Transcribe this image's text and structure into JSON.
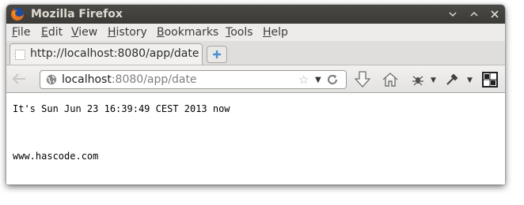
{
  "window": {
    "title": "Mozilla Firefox"
  },
  "menubar": {
    "items": [
      {
        "label": "File"
      },
      {
        "label": "Edit"
      },
      {
        "label": "View"
      },
      {
        "label": "History"
      },
      {
        "label": "Bookmarks"
      },
      {
        "label": "Tools"
      },
      {
        "label": "Help"
      }
    ]
  },
  "tabs": {
    "active_label": "http://localhost:8080/app/date"
  },
  "urlbar": {
    "host": "localhost",
    "path": ":8080/app/date"
  },
  "content": {
    "message": "It's Sun Jun 23 16:39:49 CEST 2013 now",
    "footer": "www.hascode.com"
  },
  "icons": {
    "app": "firefox-logo-icon",
    "minimize": "minimize-icon",
    "maximize": "maximize-icon",
    "close": "close-icon",
    "new_tab": "plus-icon",
    "back": "back-arrow-icon",
    "site": "globe-icon",
    "bookmark": "star-icon",
    "reload": "reload-icon",
    "downloads": "download-icon",
    "home": "home-icon",
    "addon1": "bug-icon",
    "addon2": "eyedropper-icon",
    "addon3": "grid-icon"
  },
  "colors": {
    "titlebar": "#3c3b37",
    "titlebar_text": "#dfdbd2",
    "menubar": "#edeceb",
    "url_path": "#808080",
    "new_tab_plus": "#4a8fd4"
  }
}
